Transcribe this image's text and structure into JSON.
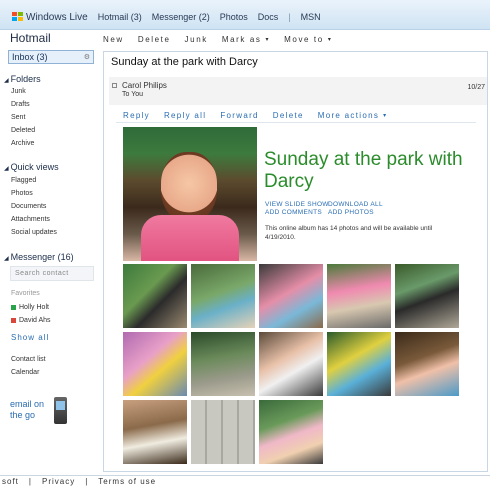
{
  "topnav": {
    "brand": "Windows Live",
    "hotmail": "Hotmail (3)",
    "messenger": "Messenger (2)",
    "photos": "Photos",
    "docs": "Docs",
    "separator": "|",
    "msn": "MSN"
  },
  "app_title": "Hotmail",
  "toolbar": {
    "new": "New",
    "delete": "Delete",
    "junk": "Junk",
    "mark_as": "Mark as",
    "move_to": "Move to"
  },
  "folders": {
    "inbox": "Inbox (3)",
    "section_title": "Folders",
    "items": [
      "Junk",
      "Drafts",
      "Sent",
      "Deleted",
      "Archive"
    ]
  },
  "quick_views": {
    "section_title": "Quick views",
    "items": [
      "Flagged",
      "Photos",
      "Documents",
      "Attachments",
      "Social updates"
    ]
  },
  "messenger": {
    "section_title": "Messenger (16)",
    "search_placeholder": "Search contact",
    "favorites_label": "Favorites",
    "contacts": [
      {
        "name": "Holly Holt",
        "status_color": "#2aa44a"
      },
      {
        "name": "David Ahs",
        "status_color": "#d9463a"
      }
    ],
    "show_all": "Show all"
  },
  "sidebar_links": {
    "contact_list": "Contact list",
    "calendar": "Calendar",
    "email_on_the_go_line1": "email on",
    "email_on_the_go_line2": "the go"
  },
  "message": {
    "subject": "Sunday at the park with Darcy",
    "sender": "Carol Philips",
    "to": "To You",
    "date": "10/27",
    "actions": [
      "Reply",
      "Reply all",
      "Forward",
      "Delete",
      "More actions"
    ],
    "album_title": "Sunday at the park with Darcy",
    "links": {
      "slide_show": "VIEW SLIDE SHOW",
      "download": "DOWNLOAD ALL",
      "add_comments": "ADD COMMENTS",
      "add_photos": "ADD PHOTOS"
    },
    "album_note": "This online album has 14 photos and will be available until 4/19/2010."
  },
  "footer": {
    "items": [
      "soft",
      "|",
      "Privacy",
      "|",
      "Terms of use"
    ]
  },
  "colors": {
    "accent": "#2a6db3",
    "album_title": "#2b8c2b",
    "topbar": "#cfe3f3"
  }
}
